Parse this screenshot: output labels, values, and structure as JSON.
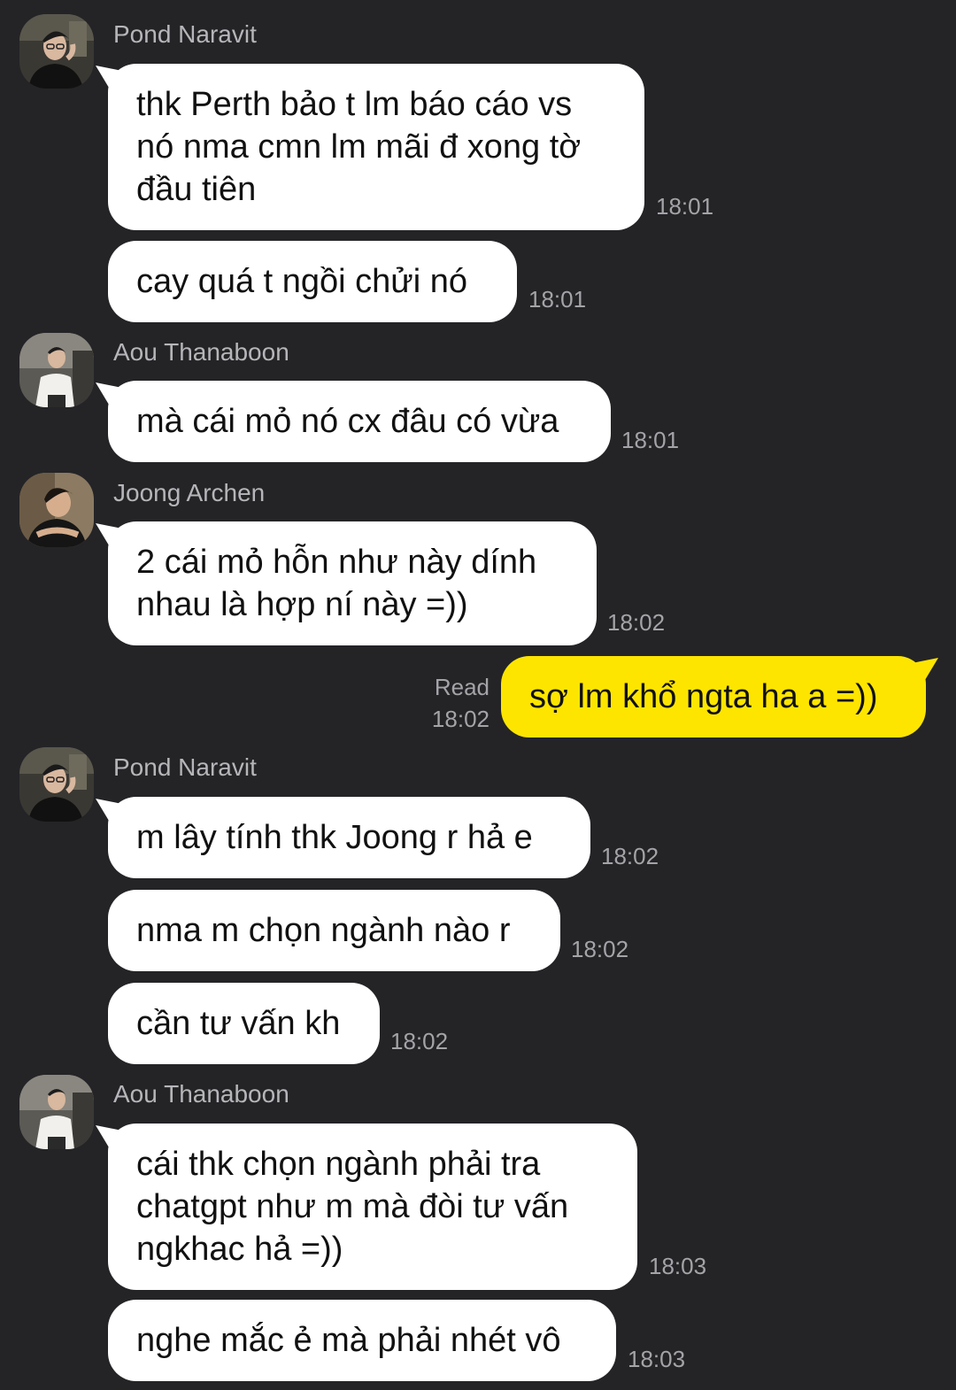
{
  "messages": [
    {
      "sender": "Pond Naravit",
      "text": "thk Perth bảo t lm báo cáo vs\nnó nma cmn lm mãi đ xong tờ\nđầu tiên",
      "time": "18:01"
    },
    {
      "text": "cay quá t ngồi chửi nó",
      "time": "18:01"
    },
    {
      "sender": "Aou Thanaboon",
      "text": "mà cái mỏ nó cx đâu có vừa",
      "time": "18:01"
    },
    {
      "sender": "Joong Archen",
      "text": "2 cái mỏ hỗn như này dính\nnhau là hợp ní này =))",
      "time": "18:02"
    },
    {
      "mine": true,
      "status": "Read",
      "text": "sợ lm khổ ngta ha a =))",
      "time": "18:02"
    },
    {
      "sender": "Pond Naravit",
      "text": "m lây tính thk Joong r hả e",
      "time": "18:02"
    },
    {
      "text": "nma m chọn ngành nào r",
      "time": "18:02"
    },
    {
      "text": "cần tư vấn kh",
      "time": "18:02"
    },
    {
      "sender": "Aou Thanaboon",
      "text": "cái thk chọn ngành phải tra\nchatgpt như m mà đòi tư vấn\nngkhac hả =))",
      "time": "18:03"
    },
    {
      "text": "nghe mắc ẻ mà phải nhét vô",
      "time": "18:03"
    }
  ],
  "colors": {
    "background": "#242427",
    "incoming_bubble": "#ffffff",
    "outgoing_bubble": "#fee500",
    "sender_name": "#b6b6ba",
    "timestamp": "#a4a4a8"
  }
}
